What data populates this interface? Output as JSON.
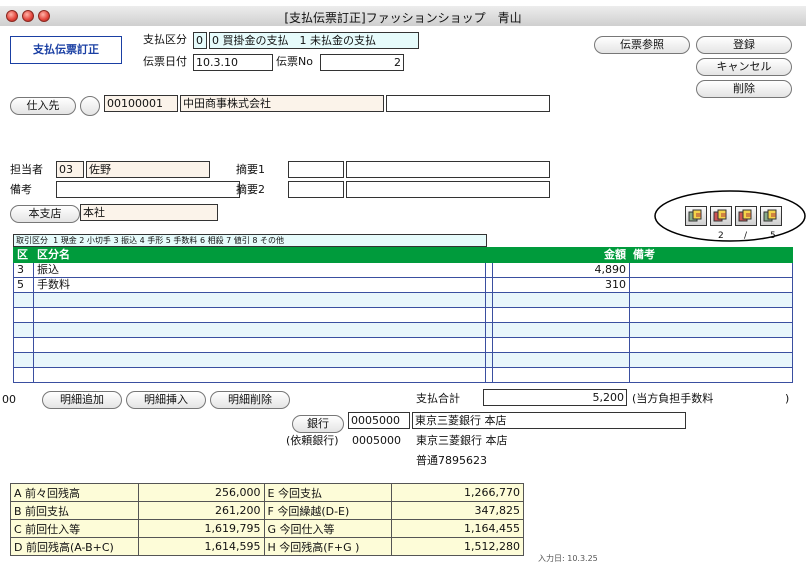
{
  "window": {
    "title": "[支払伝票訂正]ファッションショップ　青山"
  },
  "screen_label": "支払伝票訂正",
  "header": {
    "pay_kubun_label": "支払区分",
    "pay_kubun_value": "0",
    "pay_kubun_desc": "0 買掛金の支払　1 未払金の支払",
    "date_label": "伝票日付",
    "date_value": "10.3.10",
    "no_label": "伝票No",
    "no_value": "2"
  },
  "actions": {
    "ref": "伝票参照",
    "register": "登録",
    "cancel": "キャンセル",
    "delete": "削除"
  },
  "supplier": {
    "button": "仕入先",
    "code": "00100001",
    "name": "中田商事株式会社",
    "extra": ""
  },
  "staff": {
    "label": "担当者",
    "code": "03",
    "name": "佐野"
  },
  "memo1": {
    "label": "摘要1",
    "code": "",
    "text": ""
  },
  "note": {
    "label": "備考",
    "value": ""
  },
  "memo2": {
    "label": "摘要2",
    "code": "",
    "text": ""
  },
  "branch": {
    "button": "本支店",
    "value": "本社"
  },
  "pager": {
    "current": "2",
    "sep": "/",
    "total": "5"
  },
  "legend_label": "取引区分",
  "legend_text": "1 現金 2 小切手 3 振込 4 手形 5 手数料 6 相殺 7 値引 8 その他",
  "grid": {
    "headers": [
      "区",
      "区分名",
      "",
      "金額",
      "備考"
    ],
    "rows": [
      {
        "k": "3",
        "name": "振込",
        "amount": "4,890",
        "memo": ""
      },
      {
        "k": "5",
        "name": "手数料",
        "amount": "310",
        "memo": ""
      },
      {
        "k": "",
        "name": "",
        "amount": "",
        "memo": ""
      },
      {
        "k": "",
        "name": "",
        "amount": "",
        "memo": ""
      },
      {
        "k": "",
        "name": "",
        "amount": "",
        "memo": ""
      },
      {
        "k": "",
        "name": "",
        "amount": "",
        "memo": ""
      },
      {
        "k": "",
        "name": "",
        "amount": "",
        "memo": ""
      },
      {
        "k": "",
        "name": "",
        "amount": "",
        "memo": ""
      }
    ]
  },
  "row_ops": {
    "prefix": "00",
    "add": "明細追加",
    "insert": "明細挿入",
    "remove": "明細削除"
  },
  "total": {
    "label": "支払合計",
    "value": "5,200",
    "note": "(当方負担手数料",
    "close": ")"
  },
  "bank": {
    "button": "銀行",
    "code": "0005000",
    "name": "東京三菱銀行 本店",
    "req_label": "(依頼銀行)",
    "req_code": "0005000",
    "req_name": "東京三菱銀行 本店",
    "account": "普通7895623"
  },
  "summary": [
    {
      "l1": "A 前々回残高",
      "v1": "256,000",
      "l2": "E 今回支払",
      "v2": "1,266,770"
    },
    {
      "l1": "B 前回支払",
      "v1": "261,200",
      "l2": "F 今回繰越(D-E)",
      "v2": "347,825"
    },
    {
      "l1": "C 前回仕入等",
      "v1": "1,619,795",
      "l2": "G 今回仕入等",
      "v2": "1,164,455"
    },
    {
      "l1": "D 前回残高(A-B+C)",
      "v1": "1,614,595",
      "l2": "H 今回残高(F+G )",
      "v2": "1,512,280"
    }
  ],
  "input_date": "入力日: 10.3.25"
}
